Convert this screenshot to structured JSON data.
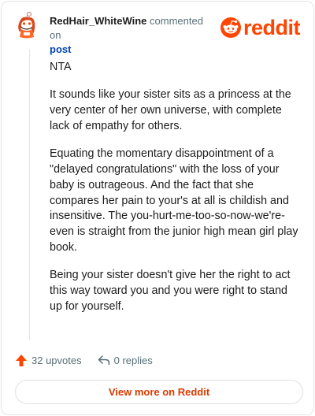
{
  "header": {
    "username": "RedHair_WhiteWine",
    "action_text": "commented on",
    "post_link": "post",
    "logo_word": "reddit"
  },
  "comment": {
    "paragraphs": [
      "NTA",
      "It sounds like your sister sits as a princess at the very center of her own universe, with complete lack of empathy for others.",
      "Equating the momentary disappointment of a \"delayed congratulations\" with the loss of your baby is outrageous. And the fact that she compares her pain to your's at all is childish and insensitive. The you-hurt-me-too-so-now-we're-even is straight from the junior high mean girl play book.",
      "Being your sister doesn't give her the right to act this way toward you and you were right to stand up for yourself."
    ]
  },
  "actions": {
    "upvotes": "32 upvotes",
    "replies": "0 replies"
  },
  "footer": {
    "view_more": "View more on Reddit"
  },
  "colors": {
    "brand": "#ff4500",
    "link": "#0045ac",
    "meta": "#576f76"
  },
  "icons": {
    "avatar": "snoo-avatar",
    "logo": "reddit-snoo-icon",
    "upvote": "upvote-arrow-icon",
    "reply": "reply-arrow-icon"
  }
}
